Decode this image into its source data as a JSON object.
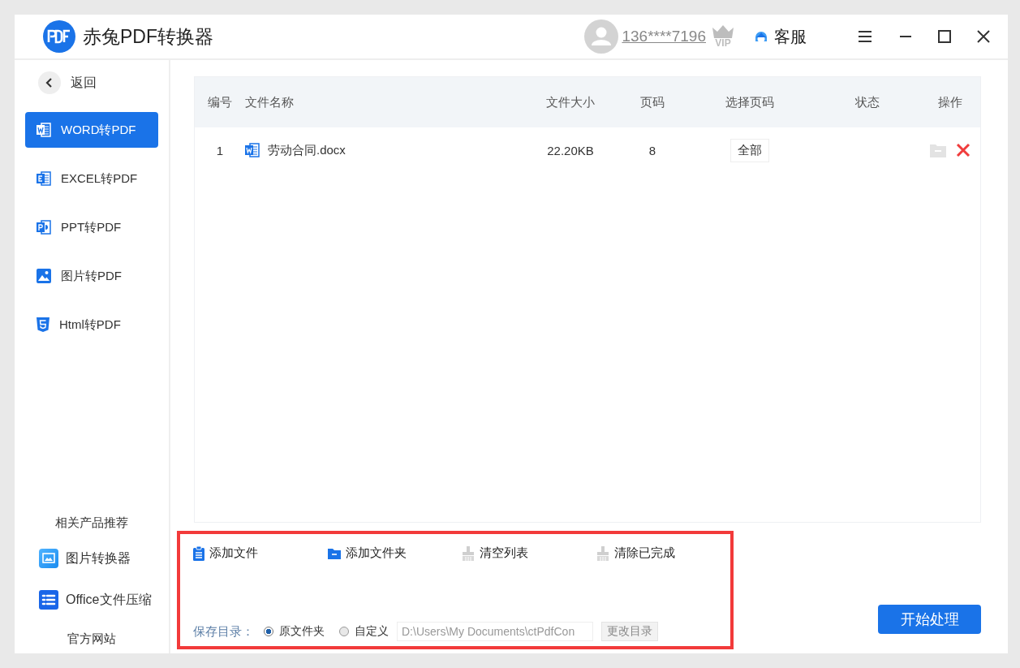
{
  "window": {
    "title": "赤兔PDF转换器"
  },
  "header": {
    "account": "136****7196",
    "vip": "VIP",
    "support": "客服"
  },
  "sidebar": {
    "back": "返回",
    "items": [
      {
        "kind": "word",
        "label": "WORD转PDF",
        "selected": true
      },
      {
        "kind": "excel",
        "label": "EXCEL转PDF",
        "selected": false
      },
      {
        "kind": "ppt",
        "label": "PPT转PDF",
        "selected": false
      },
      {
        "kind": "image",
        "label": "图片转PDF",
        "selected": false
      },
      {
        "kind": "html",
        "label": "Html转PDF",
        "selected": false
      }
    ],
    "recommend_title": "相关产品推荐",
    "products": [
      {
        "kind": "image-converter",
        "label": "图片转换器"
      },
      {
        "kind": "office-compress",
        "label": "Office文件压缩"
      }
    ],
    "website": "官方网站"
  },
  "table": {
    "columns": [
      "编号",
      "文件名称",
      "文件大小",
      "页码",
      "选择页码",
      "状态",
      "操作"
    ],
    "rows": [
      {
        "index": "1",
        "name": "劳动合同.docx",
        "size": "22.20KB",
        "pages": "8",
        "page_select": "全部"
      }
    ]
  },
  "toolbar": {
    "actions": [
      {
        "kind": "add-file",
        "label": "添加文件"
      },
      {
        "kind": "add-folder",
        "label": "添加文件夹"
      },
      {
        "kind": "clear",
        "label": "清空列表"
      },
      {
        "kind": "clear",
        "label": "清除已完成"
      }
    ],
    "save_label": "保存目录：",
    "save_options": [
      {
        "label": "原文件夹",
        "selected": true
      },
      {
        "label": "自定义",
        "selected": false
      }
    ],
    "path": "D:\\Users\\My Documents\\ctPdfCon",
    "change_dir": "更改目录"
  },
  "start_button": "开始处理"
}
